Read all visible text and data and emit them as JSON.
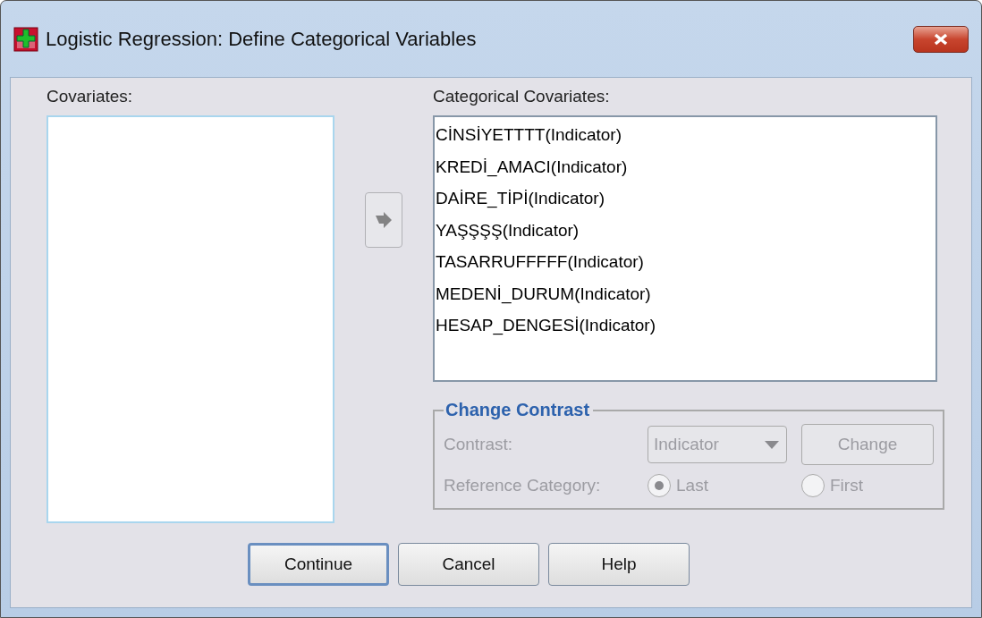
{
  "window": {
    "title": "Logistic Regression: Define Categorical Variables"
  },
  "covariates": {
    "label": "Covariates:"
  },
  "move_button": {
    "disabled": true
  },
  "categorical_covariates": {
    "label": "Categorical Covariates:",
    "items": [
      {
        "label": "CİNSİYETTTT(Indicator)",
        "selected": false
      },
      {
        "label": "KREDİ_AMACI(Indicator)",
        "selected": false
      },
      {
        "label": "DAİRE_TİPİ(Indicator)",
        "selected": false
      },
      {
        "label": "YAŞŞŞŞ(Indicator)",
        "selected": false
      },
      {
        "label": "TASARRUFFFFF(Indicator)",
        "selected": false
      },
      {
        "label": "MEDENİ_DURUM(Indicator)",
        "selected": false
      },
      {
        "label": "HESAP_DENGESİ(Indicator)",
        "selected": false
      }
    ]
  },
  "change_contrast": {
    "title": "Change Contrast",
    "disabled": true,
    "contrast_label": "Contrast:",
    "contrast_value": "Indicator",
    "change_button": "Change",
    "reference_label": "Reference Category:",
    "reference_options": [
      {
        "label": "Last",
        "selected": true
      },
      {
        "label": "First",
        "selected": false
      }
    ]
  },
  "buttons": [
    {
      "label": "Continue",
      "default": true
    },
    {
      "label": "Cancel",
      "default": false
    },
    {
      "label": "Help",
      "default": false
    }
  ]
}
